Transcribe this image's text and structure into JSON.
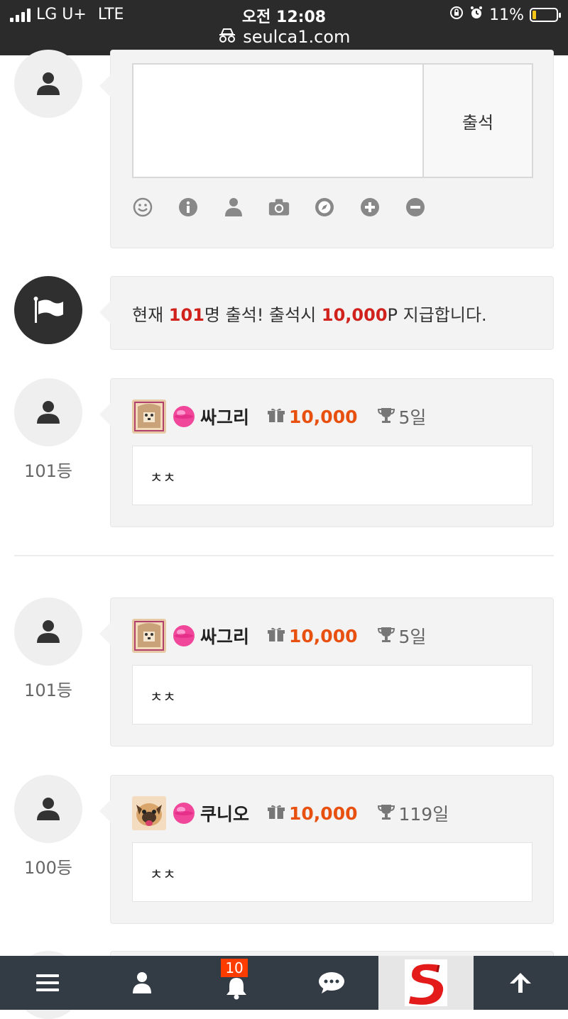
{
  "status_bar": {
    "carrier": "LG U+",
    "network": "LTE",
    "time": "오전 12:08",
    "url": "seulca1.com",
    "battery": "11%",
    "battery_level": 0.11
  },
  "compose": {
    "textarea_placeholder": "",
    "submit_label": "출석",
    "tools": [
      "smile-icon",
      "info-icon",
      "user-icon",
      "camera-icon",
      "compass-icon",
      "plus-circle-icon",
      "minus-circle-icon"
    ]
  },
  "notice": {
    "prefix": "현재 ",
    "count": "101",
    "middle": "명 출석! 출석시 ",
    "points": "10,000",
    "suffix": "P 지급합니다."
  },
  "entries": [
    {
      "rank": "101등",
      "nickname": "싸그리",
      "points": "10,000",
      "days": "5일",
      "comment": "ㅊㅊ"
    },
    {
      "rank": "101등",
      "nickname": "싸그리",
      "points": "10,000",
      "days": "5일",
      "comment": "ㅊㅊ"
    },
    {
      "rank": "100등",
      "nickname": "쿠니오",
      "points": "10,000",
      "days": "119일",
      "comment": "ㅊㅊ"
    }
  ],
  "bottom_nav": {
    "notification_count": "10"
  },
  "colors": {
    "accent_red": "#d0211c",
    "points_orange": "#e8500f",
    "nav_bg": "#333b45"
  }
}
